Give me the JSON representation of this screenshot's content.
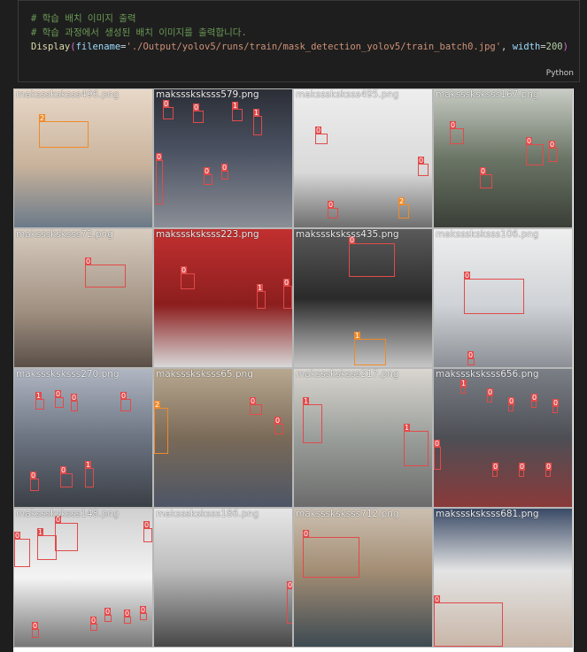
{
  "code": {
    "comment1": "# 학습 배치 이미지 출력",
    "comment2": "# 학습 과정에서 생성된 배치 이미지를 출력합니다.",
    "fn": "Display",
    "param1": "filename",
    "value1": "'./Output/yolov5/runs/train/mask_detection_yolov5/train_batch0.jpg'",
    "param2": "width",
    "value2": "200",
    "language": "Python"
  },
  "tiles": [
    {
      "label": "maksssksksss496.png",
      "bg": "#c8b8a8"
    },
    {
      "label": "maksssksksss579.png",
      "bg": "#4a4f5a"
    },
    {
      "label": "maksssksksss495.png",
      "bg": "#d9d9d9"
    },
    {
      "label": "maksssksksss167.png",
      "bg": "#5a6258"
    },
    {
      "label": "maksssksksss72.png",
      "bg": "#b5a99b"
    },
    {
      "label": "maksssksksss223.png",
      "bg": "#9a2a2a"
    },
    {
      "label": "maksssksksss435.png",
      "bg": "#3f3f3f"
    },
    {
      "label": "maksssksksss106.png",
      "bg": "#cfcfcf"
    },
    {
      "label": "maksssksksss270.png",
      "bg": "#8a8f98"
    },
    {
      "label": "maksssksksss65.png",
      "bg": "#7a6a5c"
    },
    {
      "label": "maksssksksss217.png",
      "bg": "#9a9e9a"
    },
    {
      "label": "maksssksksss656.png",
      "bg": "#5c5c66"
    },
    {
      "label": "maksssksksss148.png",
      "bg": "#8a8a8a"
    },
    {
      "label": "maksssksksss186.png",
      "bg": "#bdbdbd"
    },
    {
      "label": "maksssksksss712.png",
      "bg": "#a89a8a"
    },
    {
      "label": "maksssksksss681.png",
      "bg": "#dedede"
    }
  ]
}
